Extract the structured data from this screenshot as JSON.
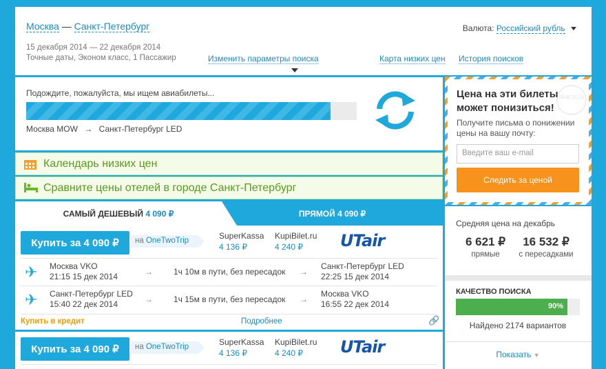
{
  "header": {
    "origin": "Москва",
    "dash": "—",
    "destination": "Санкт-Петербург",
    "dates": "15 декабря 2014 — 22 декабря 2014",
    "details": "Точные даты, Эконом класс, 1 Пассажир",
    "change_params": "Изменить параметры поиска",
    "low_price_map": "Карта низких цен",
    "search_history": "История поисков",
    "currency_label": "Валюта:",
    "currency_value": "Российский рубль"
  },
  "progress": {
    "wait_text": "Подождите, пожалуйста, мы ищем авиабилеты...",
    "percent": 92,
    "from": "Москва MOW",
    "arrow": "→",
    "to": "Санкт-Петербург LED"
  },
  "banners": {
    "calendar": "Календарь низких цен",
    "hotels": "Сравните цены отелей в городе Санкт-Петербург"
  },
  "tabs": {
    "cheapest_label": "САМЫЙ ДЕШЕВЫЙ",
    "cheapest_price": "4 090 ₽",
    "direct_label": "ПРЯМОЙ",
    "direct_price": "4 090 ₽"
  },
  "tickets": [
    {
      "buy_label": "Купить за 4 090 ₽",
      "agency_prefix": "на",
      "agency": "OneTwoTrip",
      "alt1_name": "SuperKassa",
      "alt1_price": "4 136 ₽",
      "alt2_name": "KupiBilet.ru",
      "alt2_price": "4 240 ₽",
      "airline": "UTair",
      "legs": [
        {
          "from": "Москва VKO",
          "dep": "21:15 15 дек 2014",
          "duration": "1ч 10м в пути, без пересадок",
          "to": "Санкт-Петербург LED",
          "arr": "22:25 15 дек 2014"
        },
        {
          "from": "Санкт-Петербург LED",
          "dep": "15:40 22 дек 2014",
          "duration": "1ч 15м в пути, без пересадок",
          "to": "Москва VKO",
          "arr": "16:55 22 дек 2014"
        }
      ],
      "credit": "Купить в кредит",
      "more": "Подробнее"
    },
    {
      "buy_label": "Купить за 4 090 ₽",
      "agency_prefix": "на",
      "agency": "OneTwoTrip",
      "alt1_name": "SuperKassa",
      "alt1_price": "4 136 ₽",
      "alt2_name": "KupiBilet.ru",
      "alt2_price": "4 240 ₽",
      "airline": "UTair"
    }
  ],
  "promo": {
    "title_line1": "Цена на эти билеты",
    "title_line2": "может понизиться!",
    "text": "Получите письма о понижении цены на вашу почту:",
    "email_placeholder": "Введите ваш e-mail",
    "button": "Следить за ценой",
    "stamp": "ЯНВ 2014"
  },
  "stats": {
    "avg_label": "Средняя цена на декабрь",
    "direct_price": "6 621 ₽",
    "direct_label": "прямые",
    "transfer_price": "16 532 ₽",
    "transfer_label": "с пересадками",
    "quality_label": "КАЧЕСТВО ПОИСКА",
    "quality_percent": 90,
    "quality_text": "90%",
    "found": "Найдено 2174 вариантов",
    "show": "Показать"
  },
  "colors": {
    "accent": "#1fa8dc",
    "orange": "#f7931d",
    "green": "#4cae4c",
    "utair": "#1656a8"
  }
}
